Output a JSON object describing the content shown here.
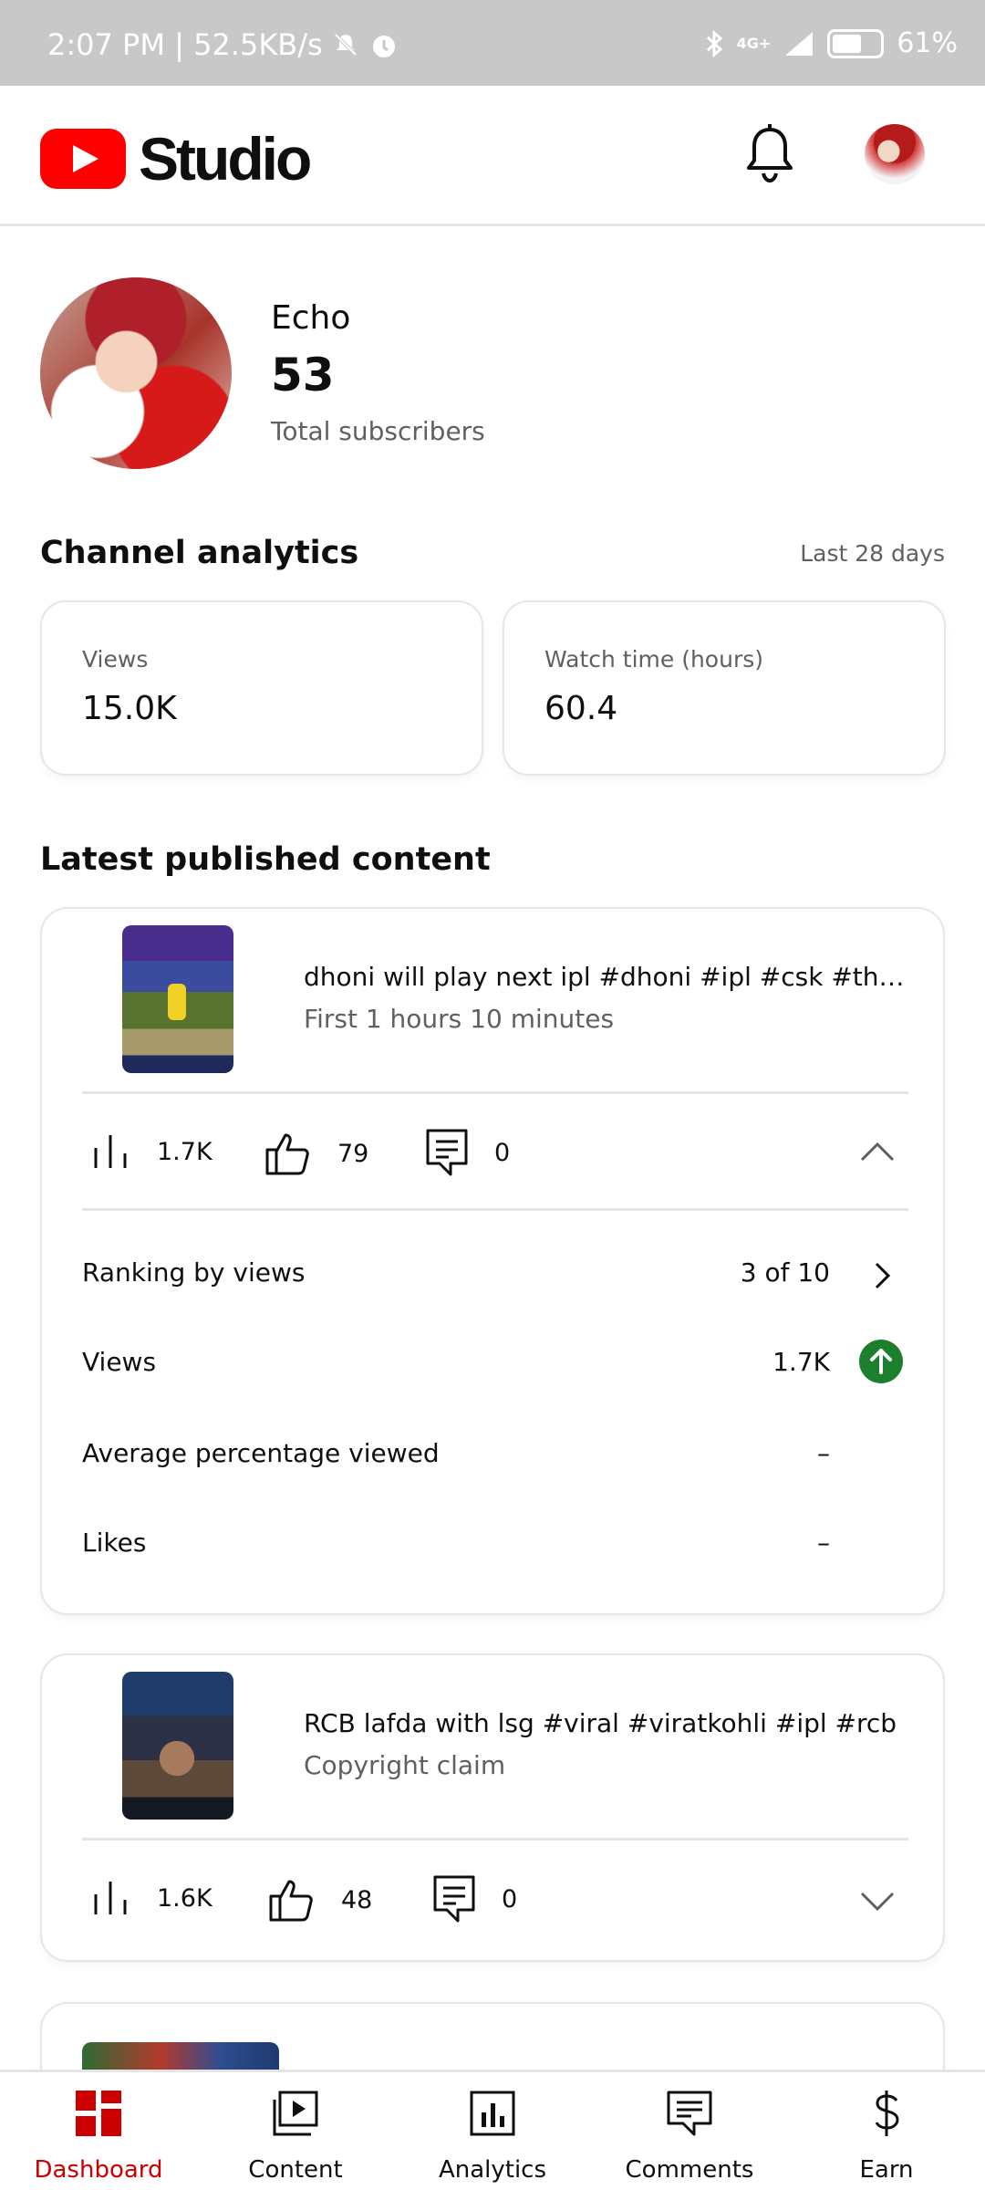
{
  "status_bar": {
    "time_network": "2:07 PM | 52.5KB/s",
    "network_type": "4G+",
    "battery": "61%",
    "battery_level": 0.61
  },
  "header": {
    "logo_text": "Studio",
    "brand_color": "#ff0000"
  },
  "channel": {
    "name": "Echo",
    "subscribers": "53",
    "subscribers_label": "Total subscribers"
  },
  "analytics": {
    "title": "Channel analytics",
    "range": "Last 28 days",
    "metrics": [
      {
        "label": "Views",
        "value": "15.0K"
      },
      {
        "label": "Watch time (hours)",
        "value": "60.4"
      }
    ]
  },
  "latest": {
    "title": "Latest published content",
    "items": [
      {
        "title": "dhoni will play next ipl #dhoni #ipl #csk #thala #...",
        "subtitle": "First 1 hours 10 minutes",
        "views": "1.7K",
        "likes": "79",
        "comments": "0",
        "expanded": true,
        "details": [
          {
            "label": "Ranking by views",
            "value": "3 of 10"
          },
          {
            "label": "Views",
            "value": "1.7K"
          },
          {
            "label": "Average percentage viewed",
            "value": "–"
          },
          {
            "label": "Likes",
            "value": "–"
          }
        ]
      },
      {
        "title": "RCB lafda with lsg #viral #viratkohli #ipl #rcb",
        "subtitle": "Copyright claim",
        "views": "1.6K",
        "likes": "48",
        "comments": "0",
        "expanded": false
      }
    ]
  },
  "bottom_nav": [
    {
      "label": "Dashboard",
      "icon": "dashboard-icon",
      "active": true
    },
    {
      "label": "Content",
      "icon": "content-icon",
      "active": false
    },
    {
      "label": "Analytics",
      "icon": "analytics-icon",
      "active": false
    },
    {
      "label": "Comments",
      "icon": "comments-icon",
      "active": false
    },
    {
      "label": "Earn",
      "icon": "dollar-icon",
      "active": false
    }
  ],
  "colors": {
    "accent_red": "#cc0000",
    "positive_green": "#1b7f2d",
    "secondary_text": "#606060"
  }
}
